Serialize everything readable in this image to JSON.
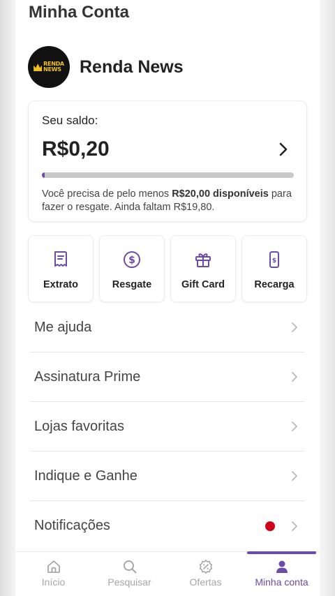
{
  "page": {
    "title": "Minha Conta"
  },
  "profile": {
    "name": "Renda News",
    "logo_text_line1": "RENDA",
    "logo_text_line2": "NEWS"
  },
  "balance": {
    "label": "Seu saldo:",
    "value": "R$0,20",
    "progress_fraction": 0.01,
    "message_prefix": "Você precisa de pelo menos ",
    "message_bold": "R$20,00 disponíveis",
    "message_suffix": " para fazer o resgate. Ainda faltam R$19,80."
  },
  "actions": [
    {
      "label": "Extrato",
      "icon": "receipt-icon"
    },
    {
      "label": "Resgate",
      "icon": "dollar-circle-icon"
    },
    {
      "label": "Gift Card",
      "icon": "gift-icon"
    },
    {
      "label": "Recarga",
      "icon": "phone-dollar-icon"
    }
  ],
  "menu": [
    {
      "label": "Me ajuda"
    },
    {
      "label": "Assinatura Prime"
    },
    {
      "label": "Lojas favoritas"
    },
    {
      "label": "Indique e Ganhe"
    },
    {
      "label": "Notificações",
      "has_dot": true
    }
  ],
  "nav": [
    {
      "label": "Início",
      "icon": "home-icon",
      "active": false
    },
    {
      "label": "Pesquisar",
      "icon": "search-icon",
      "active": false
    },
    {
      "label": "Ofertas",
      "icon": "discount-icon",
      "active": false
    },
    {
      "label": "Minha conta",
      "icon": "user-icon",
      "active": true
    }
  ],
  "colors": {
    "accent": "#6c4ba8",
    "notification_dot": "#d0021b",
    "logo_gold": "#f2c01e"
  }
}
